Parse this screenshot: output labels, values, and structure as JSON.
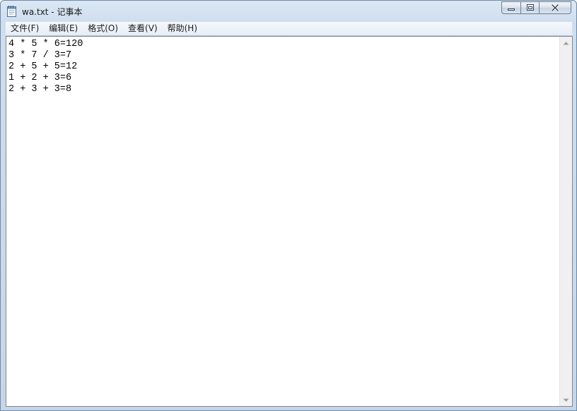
{
  "window": {
    "title": "wa.txt - 记事本"
  },
  "menu": {
    "items": [
      {
        "label": "文件(F)"
      },
      {
        "label": "编辑(E)"
      },
      {
        "label": "格式(O)"
      },
      {
        "label": "查看(V)"
      },
      {
        "label": "帮助(H)"
      }
    ]
  },
  "editor": {
    "lines": [
      "4 * 5 * 6=120",
      "3 * 7 / 3=7",
      "2 + 5 + 5=12",
      "1 + 2 + 3=6",
      "2 + 3 + 3=8"
    ]
  },
  "icons": {
    "app": "notepad-icon",
    "minimize": "minimize-icon",
    "maximize": "maximize-icon",
    "close": "close-icon",
    "scroll_up": "arrow-up-icon",
    "scroll_down": "arrow-down-icon"
  },
  "colors": {
    "frame": "#cfdeee",
    "close_hover": "#c75050"
  }
}
